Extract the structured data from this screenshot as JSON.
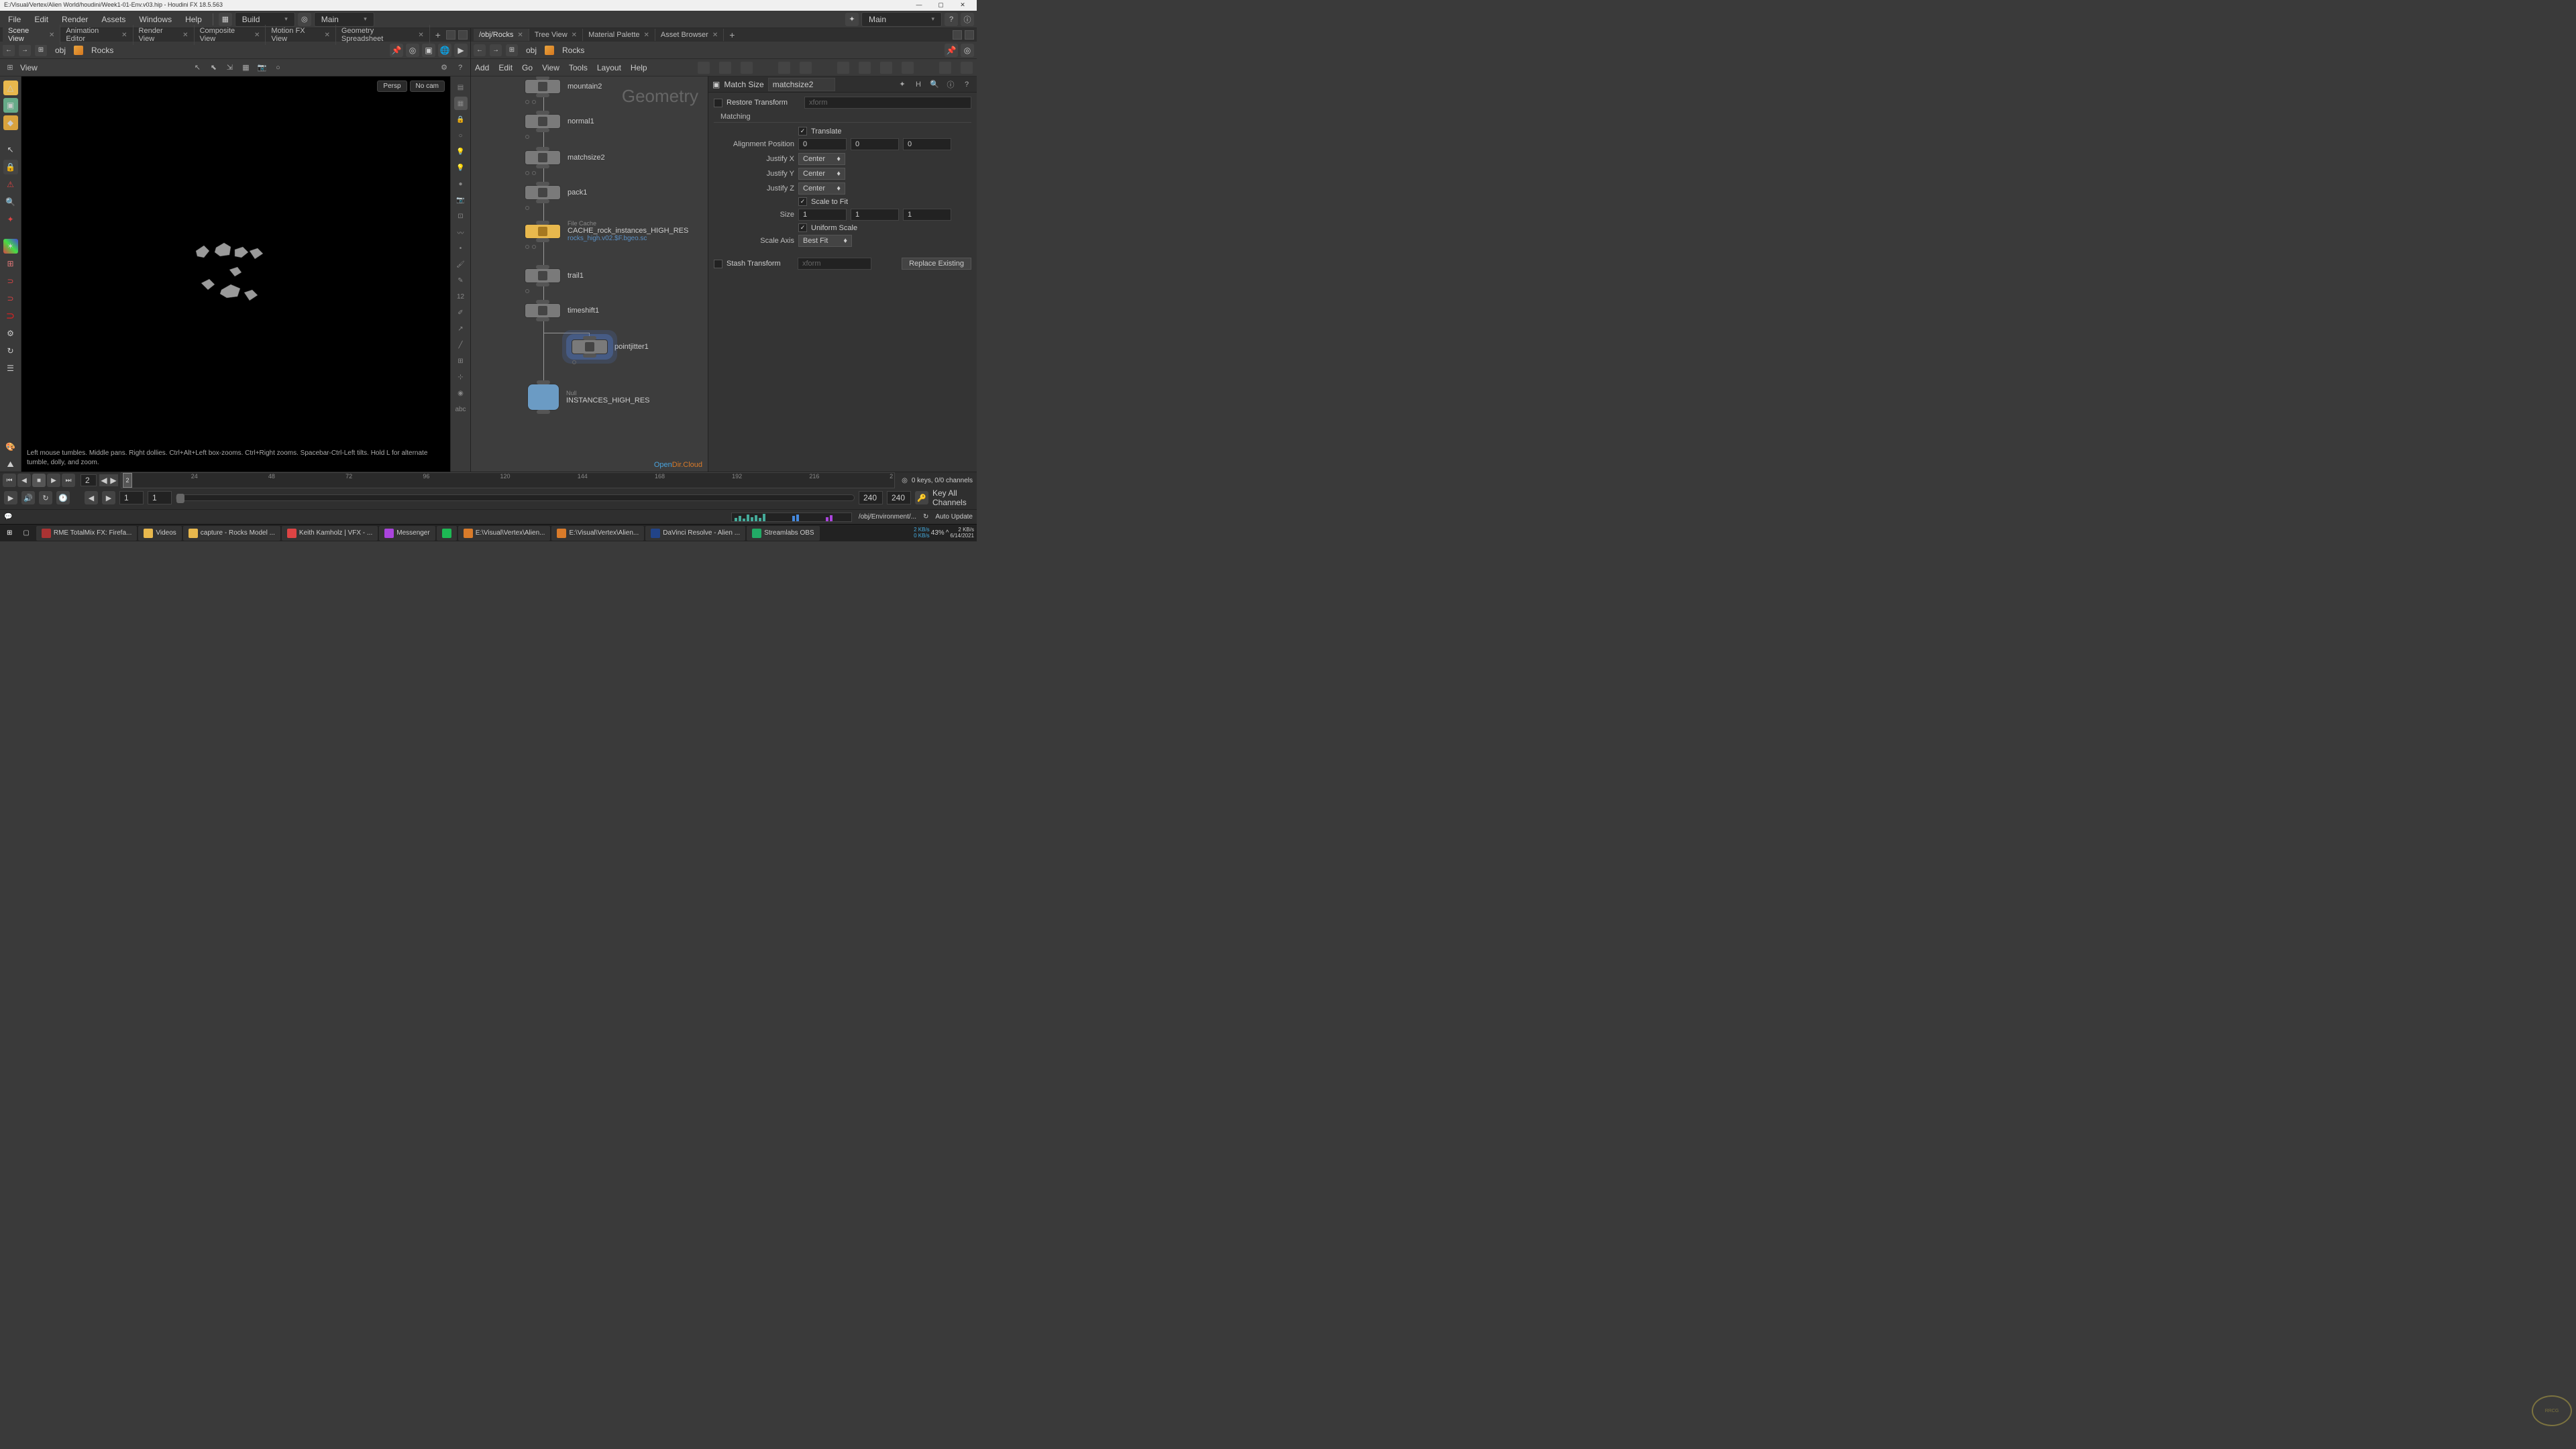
{
  "titlebar": {
    "path": "E:/Visual/Vertex/Alien World/houdini/Week1-01-Env.v03.hip - Houdini FX 18.5.563"
  },
  "menubar": {
    "file": "File",
    "edit": "Edit",
    "render": "Render",
    "assets": "Assets",
    "windows": "Windows",
    "help": "Help",
    "desktop": "Build",
    "context": "Main",
    "context2": "Main"
  },
  "left": {
    "tabs": [
      "Scene View",
      "Animation Editor",
      "Render View",
      "Composite View",
      "Motion FX View",
      "Geometry Spreadsheet"
    ],
    "active_tab": 0,
    "breadcrumb": {
      "level1": "obj",
      "level2": "Rocks"
    },
    "view_label": "View",
    "viewport": {
      "persp": "Persp",
      "nocam": "No cam"
    },
    "hint": "Left mouse tumbles. Middle pans. Right dollies. Ctrl+Alt+Left box-zooms. Ctrl+Right zooms. Spacebar-Ctrl-Left tilts. Hold L for alternate tumble, dolly, and zoom."
  },
  "right": {
    "tabs": [
      "/obj/Rocks",
      "Tree View",
      "Material Palette",
      "Asset Browser"
    ],
    "active_tab": 0,
    "breadcrumb": {
      "level1": "obj",
      "level2": "Rocks"
    },
    "menu": {
      "add": "Add",
      "edit": "Edit",
      "go": "Go",
      "view": "View",
      "tools": "Tools",
      "layout": "Layout",
      "help": "Help"
    },
    "geo_label": "Geometry",
    "nodes": {
      "mountain2": "mountain2",
      "normal1": "normal1",
      "matchsize2": "matchsize2",
      "pack1": "pack1",
      "cache_label": "File Cache",
      "cache_name": "CACHE_rock_instances_HIGH_RES",
      "cache_file": "rocks_high.v02.$F.bgeo.sc",
      "trail1": "trail1",
      "timeshift1": "timeshift1",
      "pointjitter1": "pointjitter1",
      "null_label": "Null",
      "null_name": "INSTANCES_HIGH_RES"
    },
    "opencloud1": "Open",
    "opencloud2": "Dir.Cloud"
  },
  "params": {
    "type": "Match Size",
    "name": "matchsize2",
    "restore": "Restore Transform",
    "restore_val": "xform",
    "matching": "Matching",
    "translate": "Translate",
    "align_pos": "Alignment Position",
    "align_x": "0",
    "align_y": "0",
    "align_z": "0",
    "justify_x": "Justify X",
    "justify_y": "Justify Y",
    "justify_z": "Justify Z",
    "center": "Center",
    "scale_fit": "Scale to Fit",
    "size": "Size",
    "size_x": "1",
    "size_y": "1",
    "size_z": "1",
    "uniform": "Uniform Scale",
    "scale_axis": "Scale Axis",
    "best_fit": "Best Fit",
    "stash": "Stash Transform",
    "stash_val": "xform",
    "replace": "Replace Existing"
  },
  "timeline": {
    "current": "2",
    "ticks": [
      "24",
      "48",
      "72",
      "96",
      "120",
      "144",
      "168",
      "192",
      "216",
      "2"
    ],
    "start": "1",
    "range_start": "1",
    "range_end": "240",
    "end": "240",
    "keys": "0 keys, 0/0 channels",
    "keyall": "Key All Channels"
  },
  "status": {
    "path": "/obj/Environment/...",
    "mode": "Auto Update"
  },
  "taskbar": {
    "items": [
      "RME TotalMix FX: Firefa...",
      "Videos",
      "capture - Rocks Model ...",
      "Keith Kamholz | VFX - ...",
      "Messenger",
      "",
      "E:\\Visual\\Vertex\\Alien...",
      "E:\\Visual\\Vertex\\Alien...",
      "DaVinci Resolve - Alien ...",
      "Streamlabs OBS"
    ],
    "net_up": "2 KB/s",
    "net_dn": "0 KB/s",
    "battery": "43%",
    "time": "2 KB/s",
    "date": "6/14/2021"
  }
}
